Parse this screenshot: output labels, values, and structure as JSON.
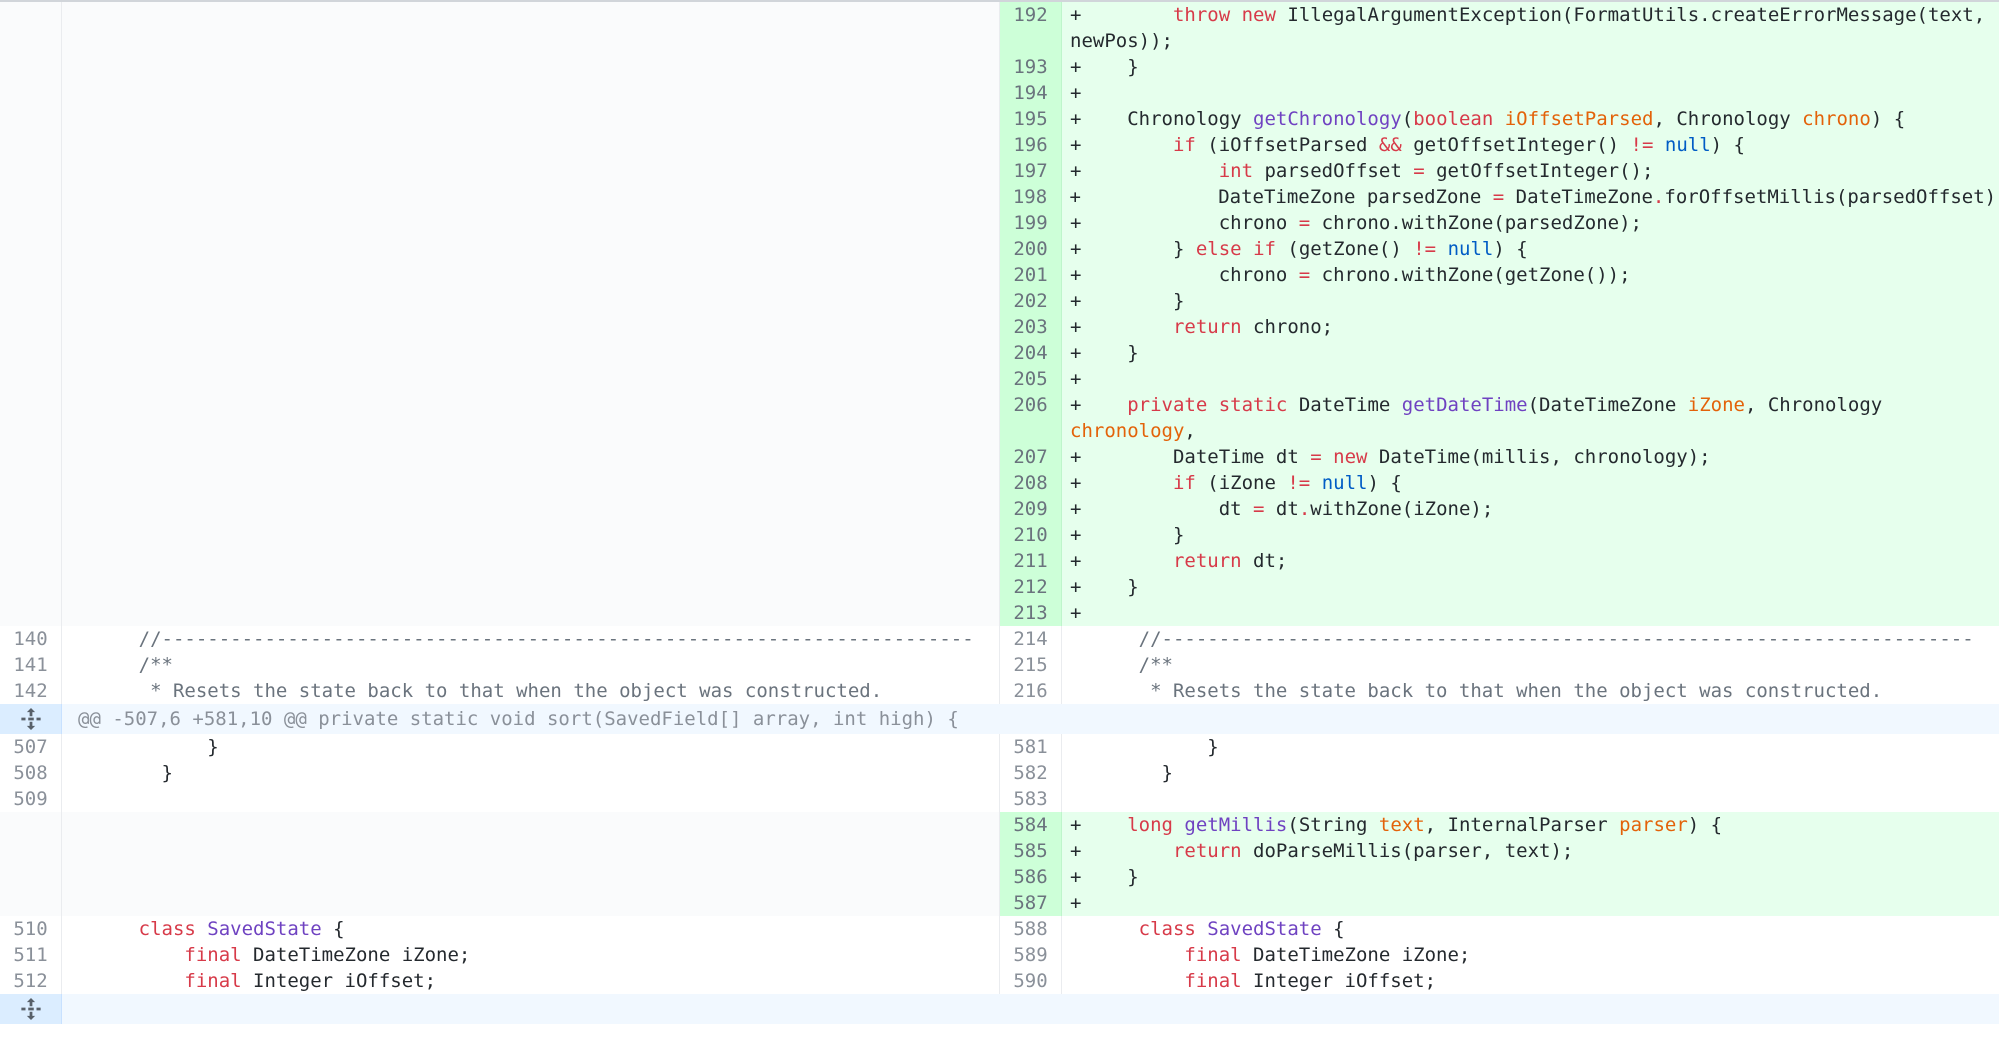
{
  "diff": {
    "rows": [
      {
        "type": "add",
        "tall": true,
        "right_num": "192",
        "right_html": "+        <span class=\"k\">throw</span> <span class=\"k\">new</span> IllegalArgumentException(FormatUtils.createErrorMessage(text,\nnewPos));"
      },
      {
        "type": "add",
        "right_num": "193",
        "right_html": "+    }"
      },
      {
        "type": "add",
        "right_num": "194",
        "right_html": "+"
      },
      {
        "type": "add",
        "right_num": "195",
        "right_html": "+    Chronology <span class=\"f\">getChronology</span>(<span class=\"k\">boolean</span> <span class=\"p\">iOffsetParsed</span>, Chronology <span class=\"p\">chrono</span>) {"
      },
      {
        "type": "add",
        "right_num": "196",
        "right_html": "+        <span class=\"k\">if</span> (iOffsetParsed <span class=\"k\">&amp;&amp;</span> getOffsetInteger() <span class=\"k\">!=</span> <span class=\"n\">null</span>) {"
      },
      {
        "type": "add",
        "right_num": "197",
        "right_html": "+            <span class=\"k\">int</span> parsedOffset <span class=\"k\">=</span> getOffsetInteger();"
      },
      {
        "type": "add",
        "right_num": "198",
        "right_html": "+            DateTimeZone parsedZone <span class=\"k\">=</span> DateTimeZone<span class=\"k\">.</span>forOffsetMillis(parsedOffset);"
      },
      {
        "type": "add",
        "right_num": "199",
        "right_html": "+            chrono <span class=\"k\">=</span> chrono.withZone(parsedZone);"
      },
      {
        "type": "add",
        "right_num": "200",
        "right_html": "+        } <span class=\"k\">else</span> <span class=\"k\">if</span> (getZone() <span class=\"k\">!=</span> <span class=\"n\">null</span>) {"
      },
      {
        "type": "add",
        "right_num": "201",
        "right_html": "+            chrono <span class=\"k\">=</span> chrono.withZone(getZone());"
      },
      {
        "type": "add",
        "right_num": "202",
        "right_html": "+        }"
      },
      {
        "type": "add",
        "right_num": "203",
        "right_html": "+        <span class=\"k\">return</span> chrono;"
      },
      {
        "type": "add",
        "right_num": "204",
        "right_html": "+    }"
      },
      {
        "type": "add",
        "right_num": "205",
        "right_html": "+"
      },
      {
        "type": "add",
        "tall": true,
        "right_num": "206",
        "right_html": "+    <span class=\"k\">private</span> <span class=\"k\">static</span> DateTime <span class=\"f\">getDateTime</span>(DateTimeZone <span class=\"p\">iZone</span>, Chronology <span class=\"p\">chronology</span>,\n<span class=\"k\">long</span> <span class=\"p\">millis</span>) {"
      },
      {
        "type": "add",
        "right_num": "207",
        "right_html": "+        DateTime dt <span class=\"k\">=</span> <span class=\"k\">new</span> DateTime(millis, chronology);"
      },
      {
        "type": "add",
        "right_num": "208",
        "right_html": "+        <span class=\"k\">if</span> (iZone <span class=\"k\">!=</span> <span class=\"n\">null</span>) {"
      },
      {
        "type": "add",
        "right_num": "209",
        "right_html": "+            dt <span class=\"k\">=</span> dt<span class=\"k\">.</span>withZone(iZone);"
      },
      {
        "type": "add",
        "right_num": "210",
        "right_html": "+        }"
      },
      {
        "type": "add",
        "right_num": "211",
        "right_html": "+        <span class=\"k\">return</span> dt;"
      },
      {
        "type": "add",
        "right_num": "212",
        "right_html": "+    }"
      },
      {
        "type": "add",
        "right_num": "213",
        "right_html": "+"
      },
      {
        "type": "ctx",
        "left_num": "140",
        "left_html": "      <span class=\"c\">//-----------------------------------------------------------------------</span>",
        "right_num": "214",
        "right_html": "      <span class=\"c\">//-----------------------------------------------------------------------</span>"
      },
      {
        "type": "ctx",
        "left_num": "141",
        "left_html": "      <span class=\"c\">/**</span>",
        "right_num": "215",
        "right_html": "      <span class=\"c\">/**</span>"
      },
      {
        "type": "ctx",
        "left_num": "142",
        "left_html": "<span class=\"c\">       * Resets the state back to that when the object was constructed.</span>",
        "right_num": "216",
        "right_html": "<span class=\"c\">       * Resets the state back to that when the object was constructed.</span>"
      },
      {
        "type": "hunk",
        "text": "@@ -507,6 +581,10 @@ private static void sort(SavedField[] array, int high) {"
      },
      {
        "type": "ctx",
        "left_num": "507",
        "left_html": "            }",
        "right_num": "581",
        "right_html": "            }"
      },
      {
        "type": "ctx",
        "left_num": "508",
        "left_html": "        }",
        "right_num": "582",
        "right_html": "        }"
      },
      {
        "type": "ctx",
        "left_num": "509",
        "left_html": "",
        "right_num": "583",
        "right_html": ""
      },
      {
        "type": "add",
        "right_num": "584",
        "right_html": "+    <span class=\"k\">long</span> <span class=\"f\">getMillis</span>(String <span class=\"p\">text</span>, InternalParser <span class=\"p\">parser</span>) {"
      },
      {
        "type": "add",
        "right_num": "585",
        "right_html": "+        <span class=\"k\">return</span> doParseMillis(parser, text);"
      },
      {
        "type": "add",
        "right_num": "586",
        "right_html": "+    }"
      },
      {
        "type": "add",
        "right_num": "587",
        "right_html": "+"
      },
      {
        "type": "ctx",
        "left_num": "510",
        "left_html": "      <span class=\"k\">class</span> <span class=\"f\">SavedState</span> {",
        "right_num": "588",
        "right_html": "      <span class=\"k\">class</span> <span class=\"f\">SavedState</span> {"
      },
      {
        "type": "ctx",
        "left_num": "511",
        "left_html": "          <span class=\"k\">final</span> DateTimeZone iZone;",
        "right_num": "589",
        "right_html": "          <span class=\"k\">final</span> DateTimeZone iZone;"
      },
      {
        "type": "ctx",
        "left_num": "512",
        "left_html": "          <span class=\"k\">final</span> Integer iOffset;",
        "right_num": "590",
        "right_html": "          <span class=\"k\">final</span> Integer iOffset;"
      },
      {
        "type": "hunk",
        "text": ""
      }
    ]
  },
  "icons": {
    "expand": "unfold-expand-icon"
  },
  "colors": {
    "added_bg": "#e6ffed",
    "added_num_bg": "#cdffd8",
    "hunk_bg": "#f1f8ff",
    "keyword": "#d73a49",
    "function": "#6f42c1",
    "param": "#e36209",
    "literal": "#005cc5"
  }
}
